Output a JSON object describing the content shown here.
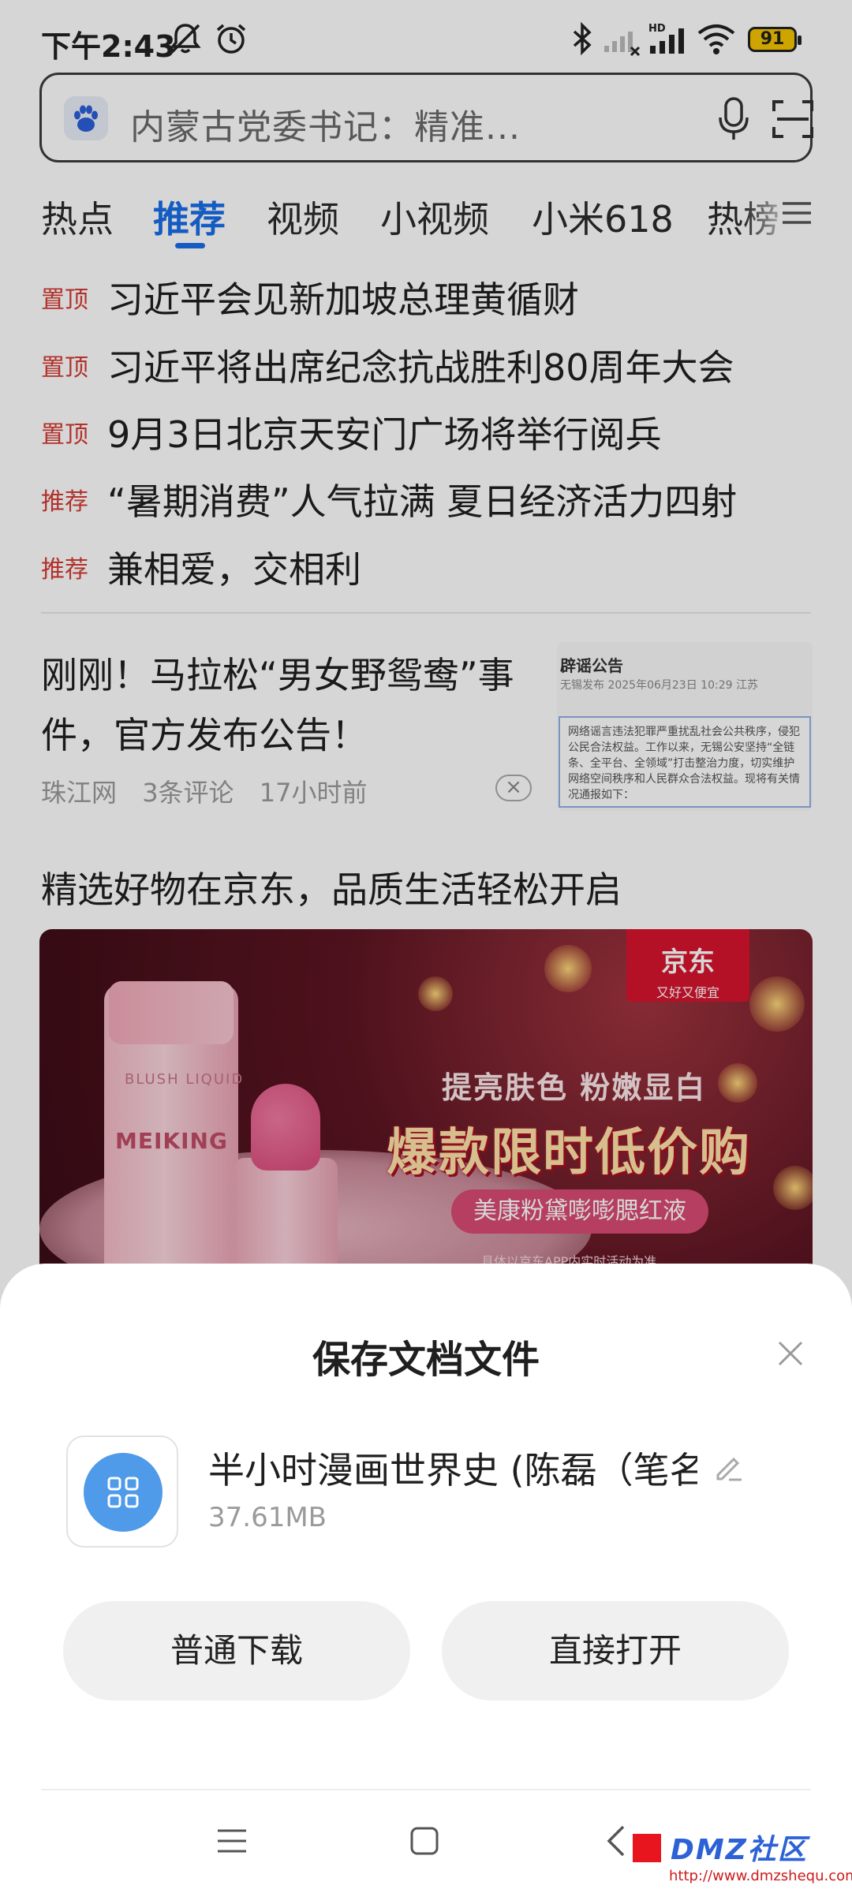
{
  "status_bar": {
    "time": "下午2:43",
    "battery": "91",
    "network_label": "HD"
  },
  "search": {
    "query": "内蒙古党委书记：精准..."
  },
  "tabs": [
    {
      "label": "热点"
    },
    {
      "label": "推荐"
    },
    {
      "label": "视频"
    },
    {
      "label": "小视频"
    },
    {
      "label": "小米618"
    },
    {
      "label": "热榜"
    }
  ],
  "headlines": [
    {
      "tag": "置顶",
      "text": "习近平会见新加坡总理黄循财"
    },
    {
      "tag": "置顶",
      "text": "习近平将出席纪念抗战胜利80周年大会"
    },
    {
      "tag": "置顶",
      "text": "9月3日北京天安门广场将举行阅兵"
    },
    {
      "tag": "推荐",
      "text": "“暑期消费”人气拉满 夏日经济活力四射"
    },
    {
      "tag": "推荐",
      "text": "兼相爱，交相利"
    }
  ],
  "article": {
    "title": "刚刚！马拉松“男女野鸳鸯”事件，官方发布公告！",
    "source": "珠江网",
    "comments": "3条评论",
    "time": "17小时前",
    "dislike_symbol": "×",
    "thumbnail": {
      "heading": "辟谣公告",
      "sub": "无锡发布 2025年06月23日 10:29 江苏",
      "body": "网络谣言违法犯罪严重扰乱社会公共秩序，侵犯公民合法权益。工作以来，无锡公安坚持“全链条、全平台、全领域”打击整治力度，切实维护网络空间秩序和人民群众合法权益。现将有关情况通报如下："
    }
  },
  "ad": {
    "title": "精选好物在京东，品质生活轻松开启",
    "brand_badge": "京东",
    "brand_slogan": "又好又便宜",
    "product_brand": "MEIKING",
    "product_sub": "BLUSH LIQUID",
    "line1": "提亮肤色 粉嫩显白",
    "line2": "爆款限时低价购",
    "line3": "美康粉黛嘭嘭腮红液",
    "note": "具体以京东APP内实时活动为准"
  },
  "sheet": {
    "title": "保存文档文件",
    "file_name": "半小时漫画世界史 (陈磊（笔名：",
    "file_size": "37.61MB",
    "btn_normal": "普通下载",
    "btn_open": "直接打开"
  },
  "watermark": {
    "text": "DMZ社区",
    "url": "http://www.dmzshequ.com"
  },
  "colors": {
    "accent": "#1a6ee8",
    "tag_red": "#d63b33",
    "jd_red": "#d7142e",
    "file_icon_blue": "#4f9ae9"
  }
}
